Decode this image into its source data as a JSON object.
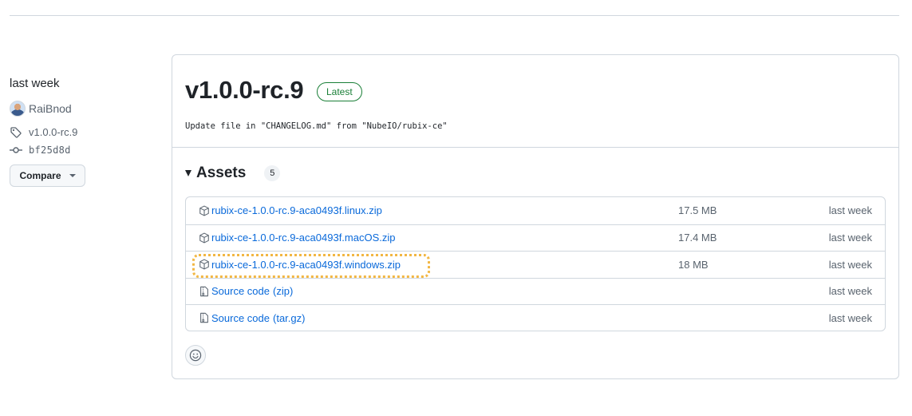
{
  "sidebar": {
    "date": "last week",
    "author": "RaiBnod",
    "tag": "v1.0.0-rc.9",
    "commit": "bf25d8d",
    "compare_label": "Compare"
  },
  "release": {
    "title": "v1.0.0-rc.9",
    "badge": "Latest",
    "body": "Update file in \"CHANGELOG.md\" from \"NubeIO/rubix-ce\""
  },
  "assets": {
    "heading": "Assets",
    "count": "5",
    "items": [
      {
        "name": "rubix-ce-1.0.0-rc.9-aca0493f.linux.zip",
        "size": "17.5 MB",
        "time": "last week",
        "icon": "package-icon"
      },
      {
        "name": "rubix-ce-1.0.0-rc.9-aca0493f.macOS.zip",
        "size": "17.4 MB",
        "time": "last week",
        "icon": "package-icon"
      },
      {
        "name": "rubix-ce-1.0.0-rc.9-aca0493f.windows.zip",
        "size": "18 MB",
        "time": "last week",
        "icon": "package-icon",
        "highlighted": true
      },
      {
        "name": "Source code",
        "sub": "(zip)",
        "time": "last week",
        "icon": "file-zip-icon"
      },
      {
        "name": "Source code",
        "sub": "(tar.gz)",
        "time": "last week",
        "icon": "file-zip-icon"
      }
    ]
  },
  "colors": {
    "link": "#0969da",
    "latest_badge": "#1a7f37",
    "highlight": "#f2b744",
    "border": "#d0d7de"
  }
}
